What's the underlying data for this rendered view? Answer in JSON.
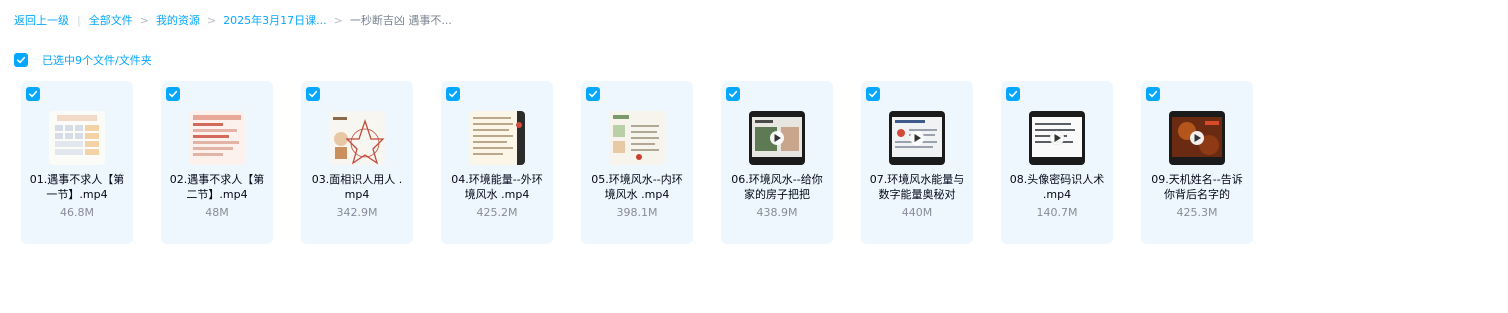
{
  "breadcrumb": {
    "back": "返回上一级",
    "items": [
      "全部文件",
      "我的资源",
      "2025年3月17日课..."
    ],
    "current": "一秒断吉凶 遇事不..."
  },
  "selection": {
    "text": "已选中9个文件/文件夹"
  },
  "files": [
    {
      "name": "01.遇事不求人【第一节】.mp4",
      "size": "46.8M"
    },
    {
      "name": "02.遇事不求人【第二节】.mp4",
      "size": "48M"
    },
    {
      "name": "03.面相识人用人 .mp4",
      "size": "342.9M"
    },
    {
      "name": "04.环境能量--外环境风水 .mp4",
      "size": "425.2M"
    },
    {
      "name": "05.环境风水--内环境风水 .mp4",
      "size": "398.1M"
    },
    {
      "name": "06.环境风水--给你家的房子把把",
      "size": "438.9M"
    },
    {
      "name": "07.环境风水能量与数字能量奥秘对",
      "size": "440M"
    },
    {
      "name": "08.头像密码识人术 .mp4",
      "size": "140.7M"
    },
    {
      "name": "09.天机姓名--告诉你背后名字的",
      "size": "425.3M"
    }
  ],
  "colors": {
    "accent": "#06a7ff",
    "card_bg": "#eef7fe"
  }
}
